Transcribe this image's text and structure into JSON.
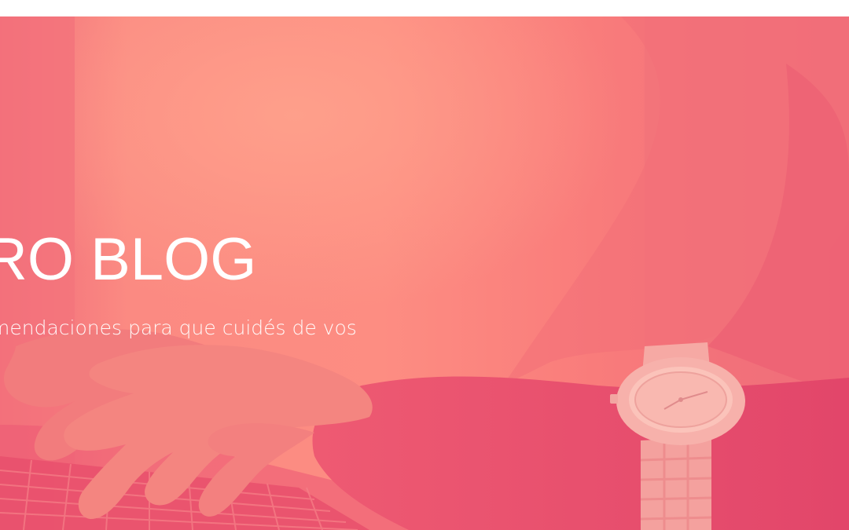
{
  "hero": {
    "title": "RO BLOG",
    "subtitle": "mendaciones para que cuidés de vos"
  },
  "colors": {
    "overlay_light": "#fd8d82",
    "overlay_deep": "#e8446b",
    "text": "#ffffff"
  },
  "icons": [
    "wristwatch-illustration",
    "keyboard-illustration",
    "hands-illustration"
  ]
}
